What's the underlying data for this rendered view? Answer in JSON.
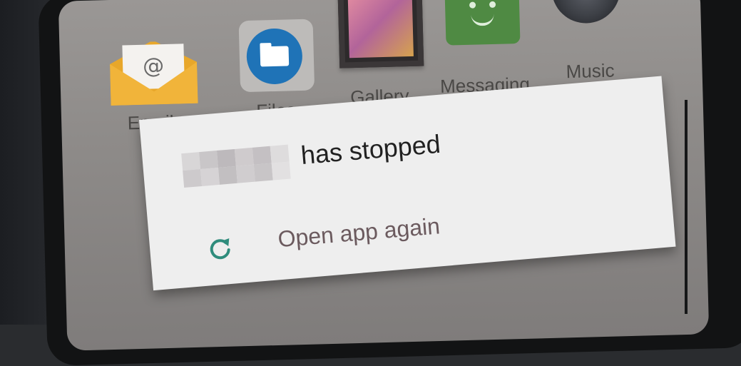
{
  "home_screen": {
    "apps": [
      {
        "name": "email",
        "label": "Email",
        "icon": "email-icon"
      },
      {
        "name": "files",
        "label": "Files",
        "icon": "files-icon"
      },
      {
        "name": "gallery",
        "label": "Gallery",
        "icon": "gallery-icon"
      },
      {
        "name": "messaging",
        "label": "Messaging",
        "icon": "messaging-icon"
      },
      {
        "name": "music",
        "label": "Music",
        "icon": "music-icon"
      }
    ]
  },
  "dialog": {
    "title": "has stopped",
    "app_name_redacted": true,
    "action": {
      "label": "Open app again",
      "icon": "refresh-icon",
      "icon_color": "#2f8c7c"
    }
  },
  "colors": {
    "dialog_background": "#eeeeee",
    "title_text": "#212121",
    "action_text": "#6b5a5e"
  }
}
